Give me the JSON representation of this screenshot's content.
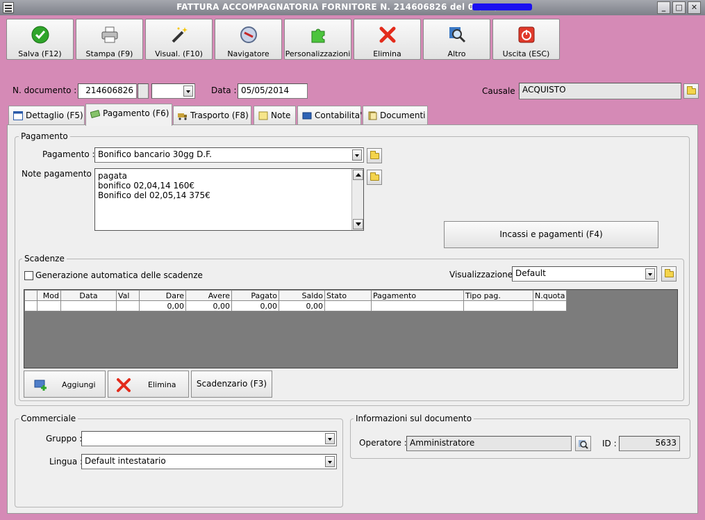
{
  "window": {
    "title": "FATTURA ACCOMPAGNATORIA FORNITORE N. 214606826 del 05/05/2014 -",
    "minimize": "_",
    "maximize": "□",
    "close": "✕"
  },
  "toolbar": [
    {
      "label": "Salva (F12)",
      "icon": "check-icon"
    },
    {
      "label": "Stampa (F9)",
      "icon": "printer-icon"
    },
    {
      "label": "Visual. (F10)",
      "icon": "magic-wand-icon"
    },
    {
      "label": "Navigatore",
      "icon": "compass-icon"
    },
    {
      "label": "Personalizzazioni",
      "icon": "puzzle-icon"
    },
    {
      "label": "Elimina",
      "icon": "delete-x-icon"
    },
    {
      "label": "Altro",
      "icon": "magnifier-icon"
    },
    {
      "label": "Uscita (ESC)",
      "icon": "power-icon"
    }
  ],
  "header": {
    "doc_label": "N. documento :",
    "doc_number": "214606826",
    "doc_suffix": "",
    "date_label": "Data :",
    "date": "05/05/2014",
    "causale_label": "Causale :",
    "causale": "ACQUISTO"
  },
  "tabs": [
    {
      "label": "Dettaglio (F5)"
    },
    {
      "label": "Pagamento (F6)"
    },
    {
      "label": "Trasporto (F8)"
    },
    {
      "label": "Note"
    },
    {
      "label": "Contabilita'"
    },
    {
      "label": "Documenti"
    }
  ],
  "pagamento": {
    "group_title": "Pagamento",
    "pagamento_label": "Pagamento :",
    "pagamento_value": "Bonifico bancario 30gg D.F.",
    "note_label": "Note pagamento :",
    "note_lines": [
      "pagata",
      "bonifico 02,04,14 160€",
      "Bonifico del 02,05,14 375€"
    ],
    "incassi_button": "Incassi e pagamenti (F4)"
  },
  "scadenze": {
    "group_title": "Scadenze",
    "auto_label": "Generazione automatica delle scadenze",
    "auto_checked": false,
    "visual_label": "Visualizzazione :",
    "visual_value": "Default",
    "columns": [
      "Mod",
      "Data",
      "Val",
      "Dare",
      "Avere",
      "Pagato",
      "Saldo",
      "Stato",
      "Pagamento",
      "Tipo pag.",
      "N.quota"
    ],
    "row": [
      "",
      "",
      "",
      "0,00",
      "0,00",
      "0,00",
      "0,00",
      "",
      "",
      "",
      ""
    ],
    "add_button": "Aggiungi",
    "delete_button": "Elimina",
    "scadenzario_button": "Scadenzario (F3)"
  },
  "commerciale": {
    "group_title": "Commerciale",
    "gruppo_label": "Gruppo :",
    "gruppo_value": "",
    "lingua_label": "Lingua :",
    "lingua_value": "Default intestatario"
  },
  "info": {
    "group_title": "Informazioni sul documento",
    "operatore_label": "Operatore :",
    "operatore_value": "Amministratore",
    "id_label": "ID :",
    "id_value": "5633"
  }
}
